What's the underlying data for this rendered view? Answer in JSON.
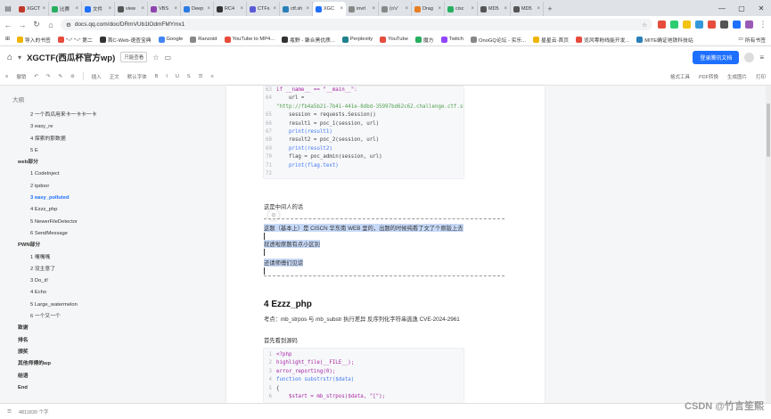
{
  "tabs": [
    {
      "title": "XGCT",
      "color": "#c0392b"
    },
    {
      "title": "比赛",
      "color": "#27ae60"
    },
    {
      "title": "文件",
      "color": "#1e6fff"
    },
    {
      "title": "view",
      "color": "#555555"
    },
    {
      "title": "VBS",
      "color": "#8e44ad"
    },
    {
      "title": "Deep",
      "color": "#2c7be5"
    },
    {
      "title": "RC4",
      "color": "#333333"
    },
    {
      "title": "CTFs",
      "color": "#5a5ad6"
    },
    {
      "title": "ctf.sh",
      "color": "#2980b9"
    },
    {
      "title": "XGC",
      "color": "#1e6fff",
      "active": true
    },
    {
      "title": "invrl",
      "color": "#888888"
    },
    {
      "title": "(o'v'",
      "color": "#888888"
    },
    {
      "title": "Drag",
      "color": "#e67e22"
    },
    {
      "title": "cisc",
      "color": "#27ae60"
    },
    {
      "title": "MD5",
      "color": "#555555"
    },
    {
      "title": "MD5",
      "color": "#555555"
    }
  ],
  "address": {
    "url": "docs.qq.com/doc/DRmVUb1lOdmFMYmx1"
  },
  "extensions": [
    "#e74c3c",
    "#2ecc71",
    "#f1c40f",
    "#3498db",
    "#e74c3c",
    "#555555",
    "#1e6fff",
    "#9b59b6"
  ],
  "bookmarks": [
    {
      "label": "导入的书签",
      "color": "#f0b400"
    },
    {
      "label": "\"~\" \"~\" 第二",
      "color": "#e74c3c"
    },
    {
      "label": "首C-Web-速查宝典",
      "color": "#333333"
    },
    {
      "label": "Google",
      "color": "#4285f4"
    },
    {
      "label": "Ranzoid",
      "color": "#888888"
    },
    {
      "label": "YouTube to MP4...",
      "color": "#e74c3c"
    },
    {
      "label": "瓶野 - 聚合黑优质...",
      "color": "#333333"
    },
    {
      "label": "Perplexity",
      "color": "#20808d"
    },
    {
      "label": "YouTube",
      "color": "#e74c3c"
    },
    {
      "label": "魔方",
      "color": "#27ae60"
    },
    {
      "label": "Twitch",
      "color": "#9146ff"
    },
    {
      "label": "OnoGQ论坛 - 实乐...",
      "color": "#888888"
    },
    {
      "label": "星星云·首页",
      "color": "#f0b400"
    },
    {
      "label": "览风零粉线能开发...",
      "color": "#e74c3c"
    },
    {
      "label": "MITE确证地铁科技站",
      "color": "#2980b9"
    }
  ],
  "bookmarks_all": "所有书签",
  "doc": {
    "title": "XGCTF(西瓜杯官方wp)",
    "readonly": "只能查看",
    "login": "登录腾讯文档"
  },
  "toolbar": {
    "items": [
      "撤销",
      "插入",
      "正文",
      "默认字体",
      "格式工具",
      "PDF转换",
      "生成图片",
      "打印"
    ]
  },
  "outline": {
    "head": "大纲",
    "items": [
      {
        "label": "2 一个西瓜用来卡一卡卡一卡",
        "level": 2
      },
      {
        "label": "3 easy_re",
        "level": 2
      },
      {
        "label": "4 探索的那数据",
        "level": 2
      },
      {
        "label": "5 E",
        "level": 2
      },
      {
        "label": "web部分",
        "level": 1
      },
      {
        "label": "1 CodeInject",
        "level": 2
      },
      {
        "label": "2 tpdoor",
        "level": 2
      },
      {
        "label": "3 easy_polluted",
        "level": 2,
        "active": true
      },
      {
        "label": "4 Ezzz_php",
        "level": 2
      },
      {
        "label": "5 NewerFileDetector",
        "level": 2
      },
      {
        "label": "6 SendMessage",
        "level": 2
      },
      {
        "label": "PWN部分",
        "level": 1
      },
      {
        "label": "1 嘴嘴嘴",
        "level": 2
      },
      {
        "label": "2 没主意了",
        "level": 2
      },
      {
        "label": "3 Do_it!",
        "level": 2
      },
      {
        "label": "4 Echo",
        "level": 2
      },
      {
        "label": "5 Large_watermelon",
        "level": 2
      },
      {
        "label": "6 一个又一个",
        "level": 2
      },
      {
        "label": "致谢",
        "level": 1
      },
      {
        "label": "排名",
        "level": 1
      },
      {
        "label": "颁奖",
        "level": 1
      },
      {
        "label": "其他师傅的wp",
        "level": 1
      },
      {
        "label": "结语",
        "level": 1
      },
      {
        "label": "End",
        "level": 1
      }
    ]
  },
  "code1": [
    {
      "ln": "63",
      "text": "if __name__ == \"__main__\":",
      "cls": "kw"
    },
    {
      "ln": "64",
      "text": "    url =",
      "cls": ""
    },
    {
      "ln": "",
      "text": "\"http://fb4a5b21-7b41-441e-8dbd-35997bd62c62.challenge.ctf.show/\"",
      "cls": "str"
    },
    {
      "ln": "65",
      "text": "    session = requests.Session()",
      "cls": ""
    },
    {
      "ln": "66",
      "text": "    result1 = poc_1(session, url)",
      "cls": ""
    },
    {
      "ln": "67",
      "text": "    print(result1)",
      "cls": "fn"
    },
    {
      "ln": "68",
      "text": "    result2 = poc_2(session, url)",
      "cls": ""
    },
    {
      "ln": "69",
      "text": "    print(result2)",
      "cls": "fn"
    },
    {
      "ln": "70",
      "text": "    flag = poc_admin(session, url)",
      "cls": ""
    },
    {
      "ln": "71",
      "text": "    print(flag.text)",
      "cls": "fn"
    },
    {
      "ln": "72",
      "text": "",
      "cls": ""
    }
  ],
  "texts": {
    "p1": "这是中间人的话",
    "p2": "这题（基本上）是 CISCN 华东南 WEB 里的，出题的时候纯看了文了个原版上去",
    "p3": "就透啦原题有点小区别",
    "p4": "还请师傅们见谅",
    "h4": "4  Ezzz_php",
    "p5": "考点：mb_strpos 与 mb_substr 执行差异 反序列化字符串逃逸 CVE-2024-2961",
    "p6": "首先看到源码"
  },
  "code2": [
    {
      "ln": "1",
      "text": "<?php",
      "cls": "kw"
    },
    {
      "ln": "2",
      "text": "highlight_file(__FILE__);",
      "cls": "kw"
    },
    {
      "ln": "3",
      "text": "error_reporting(0);",
      "cls": "kw"
    },
    {
      "ln": "4",
      "text": "function substrstr($data)",
      "cls": "fn"
    },
    {
      "ln": "5",
      "text": "{",
      "cls": ""
    },
    {
      "ln": "6",
      "text": "    $start = mb_strpos($data, \"[\");",
      "cls": "kw"
    }
  ],
  "status": {
    "words": "4811830 个字"
  },
  "watermark": "CSDN @竹言笙熙"
}
